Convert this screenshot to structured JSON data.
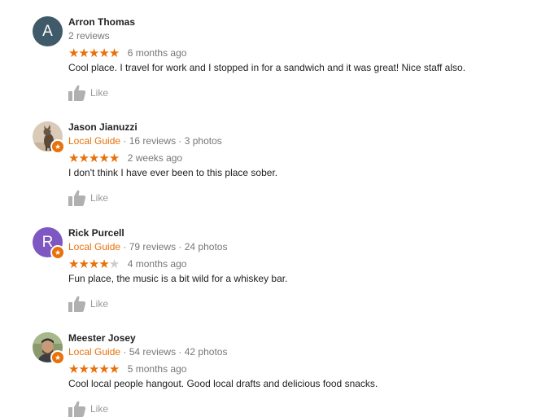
{
  "colors": {
    "accent": "#e8710a",
    "muted": "#777777",
    "star_empty": "#cccccc",
    "like_icon": "#b0b0b0"
  },
  "reviews": [
    {
      "avatar_letter": "A",
      "avatar_color": "#3f5a68",
      "name": "Arron Thomas",
      "local_guide": "",
      "reviews_text": "2 reviews",
      "photos_text": "",
      "rating": 5,
      "time": "6 months ago",
      "text": "Cool place. I travel for work and I stopped in for a sandwich and it was great! Nice staff also.",
      "like_label": "Like"
    },
    {
      "avatar_letter": "",
      "avatar_icon": "profile-photo-dog",
      "name": "Jason Jianuzzi",
      "local_guide": "Local Guide",
      "reviews_text": "16 reviews",
      "photos_text": "3 photos",
      "rating": 5,
      "time": "2 weeks ago",
      "text": "I don't think I have ever been to this place sober.",
      "like_label": "Like"
    },
    {
      "avatar_letter": "R",
      "avatar_color": "#7e57c2",
      "name": "Rick Purcell",
      "local_guide": "Local Guide",
      "reviews_text": "79 reviews",
      "photos_text": "24 photos",
      "rating": 4,
      "time": "4 months ago",
      "text": "Fun place,  the music is a bit wild for a whiskey bar.",
      "like_label": "Like"
    },
    {
      "avatar_letter": "",
      "avatar_icon": "profile-photo-man",
      "name": "Meester Josey",
      "local_guide": "Local Guide",
      "reviews_text": "54 reviews",
      "photos_text": "42 photos",
      "rating": 5,
      "time": "5 months ago",
      "text": "Cool local people hangout. Good local drafts and delicious food snacks.",
      "like_label": "Like"
    }
  ],
  "separator": " · "
}
